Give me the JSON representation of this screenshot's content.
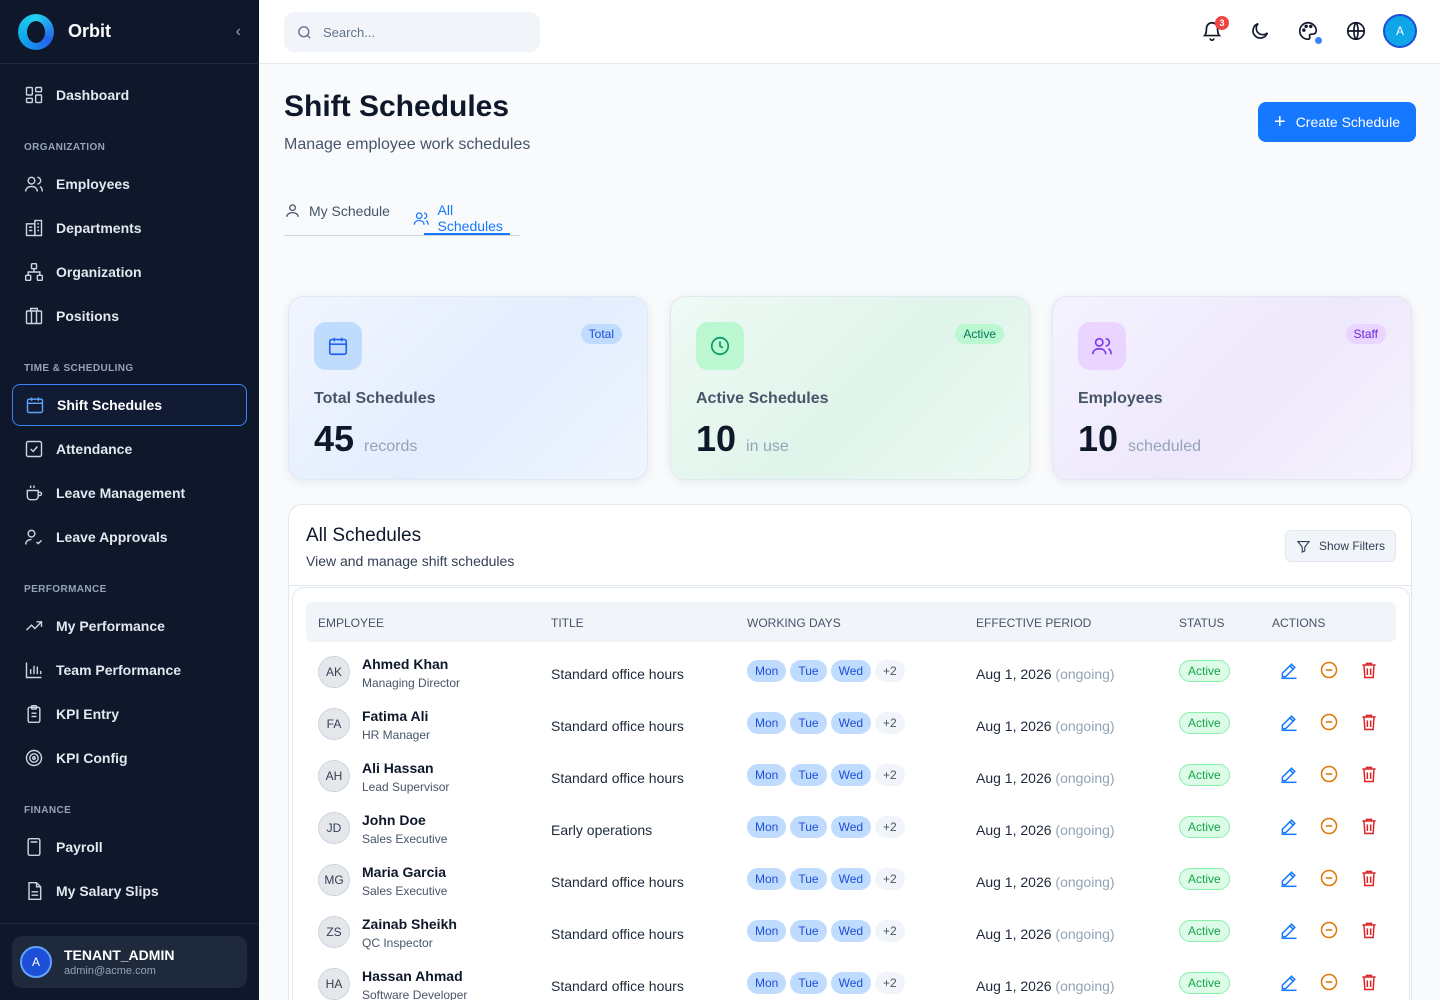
{
  "app": {
    "name": "Orbit"
  },
  "sidebar": {
    "dashboard": "Dashboard",
    "sections": [
      {
        "title": "ORGANIZATION",
        "items": [
          "Employees",
          "Departments",
          "Organization",
          "Positions"
        ]
      },
      {
        "title": "TIME & SCHEDULING",
        "items": [
          "Shift Schedules",
          "Attendance",
          "Leave Management",
          "Leave Approvals"
        ]
      },
      {
        "title": "PERFORMANCE",
        "items": [
          "My Performance",
          "Team Performance",
          "KPI Entry",
          "KPI Config"
        ]
      },
      {
        "title": "FINANCE",
        "items": [
          "Payroll",
          "My Salary Slips"
        ]
      }
    ],
    "active_item": "Shift Schedules",
    "user": {
      "initial": "A",
      "role": "TENANT_ADMIN",
      "email": "admin@acme.com"
    }
  },
  "topbar": {
    "search_placeholder": "Search...",
    "notification_count": "3",
    "avatar_initial": "A",
    "icons": [
      "bell-icon",
      "moon-icon",
      "palette-icon",
      "globe-icon"
    ]
  },
  "page": {
    "title": "Shift Schedules",
    "subtitle": "Manage employee work schedules",
    "create_button": "Create Schedule"
  },
  "tabs": [
    {
      "label": "My Schedule",
      "active": false
    },
    {
      "label": "All Schedules",
      "active": true
    }
  ],
  "stats": [
    {
      "badge": "Total",
      "label": "Total Schedules",
      "value": "45",
      "unit": "records",
      "accent": "#2563eb"
    },
    {
      "badge": "Active",
      "label": "Active Schedules",
      "value": "10",
      "unit": "in use",
      "accent": "#059669"
    },
    {
      "badge": "Staff",
      "label": "Employees",
      "value": "10",
      "unit": "scheduled",
      "accent": "#7c3aed"
    }
  ],
  "table": {
    "title": "All Schedules",
    "subtitle": "View and manage shift schedules",
    "filter_button": "Show Filters",
    "columns": [
      "EMPLOYEE",
      "TITLE",
      "WORKING DAYS",
      "EFFECTIVE PERIOD",
      "STATUS",
      "ACTIONS"
    ],
    "rows": [
      {
        "initials": "AK",
        "name": "Ahmed Khan",
        "role": "Managing Director",
        "title": "Standard office hours",
        "days": [
          "Mon",
          "Tue",
          "Wed"
        ],
        "more": "+2",
        "period": "Aug 1, 2026",
        "period_note": "(ongoing)",
        "status": "Active"
      },
      {
        "initials": "FA",
        "name": "Fatima Ali",
        "role": "HR Manager",
        "title": "Standard office hours",
        "days": [
          "Mon",
          "Tue",
          "Wed"
        ],
        "more": "+2",
        "period": "Aug 1, 2026",
        "period_note": "(ongoing)",
        "status": "Active"
      },
      {
        "initials": "AH",
        "name": "Ali Hassan",
        "role": "Lead Supervisor",
        "title": "Standard office hours",
        "days": [
          "Mon",
          "Tue",
          "Wed"
        ],
        "more": "+2",
        "period": "Aug 1, 2026",
        "period_note": "(ongoing)",
        "status": "Active"
      },
      {
        "initials": "JD",
        "name": "John Doe",
        "role": "Sales Executive",
        "title": "Early operations",
        "days": [
          "Mon",
          "Tue",
          "Wed"
        ],
        "more": "+2",
        "period": "Aug 1, 2026",
        "period_note": "(ongoing)",
        "status": "Active"
      },
      {
        "initials": "MG",
        "name": "Maria Garcia",
        "role": "Sales Executive",
        "title": "Standard office hours",
        "days": [
          "Mon",
          "Tue",
          "Wed"
        ],
        "more": "+2",
        "period": "Aug 1, 2026",
        "period_note": "(ongoing)",
        "status": "Active"
      },
      {
        "initials": "ZS",
        "name": "Zainab Sheikh",
        "role": "QC Inspector",
        "title": "Standard office hours",
        "days": [
          "Mon",
          "Tue",
          "Wed"
        ],
        "more": "+2",
        "period": "Aug 1, 2026",
        "period_note": "(ongoing)",
        "status": "Active"
      },
      {
        "initials": "HA",
        "name": "Hassan Ahmad",
        "role": "Software Developer",
        "title": "Standard office hours",
        "days": [
          "Mon",
          "Tue",
          "Wed"
        ],
        "more": "+2",
        "period": "Aug 1, 2026",
        "period_note": "(ongoing)",
        "status": "Active"
      }
    ]
  }
}
